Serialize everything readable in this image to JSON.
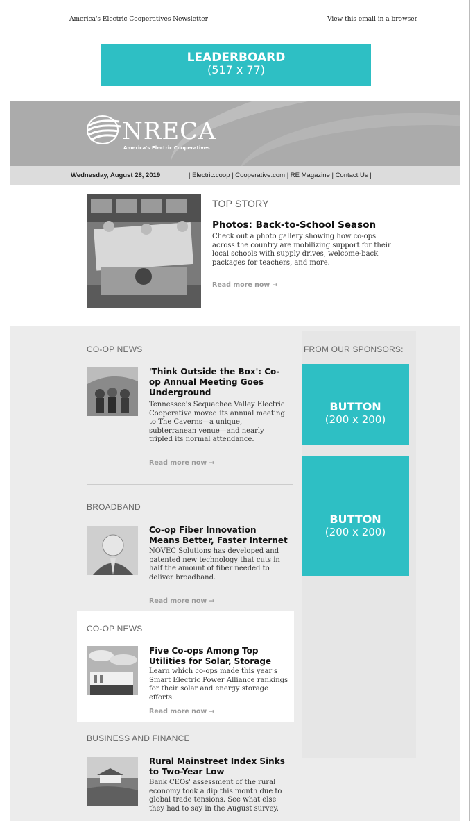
{
  "topbar": {
    "newsletter_title": "America's Electric Cooperatives Newsletter",
    "browser_link": "View this email in a browser"
  },
  "leaderboard": {
    "title": "LEADERBOARD",
    "size": "(517 x 77)"
  },
  "header": {
    "logo_name": "NRECA",
    "logo_sub": "America's Electric Cooperatives",
    "date": "Wednesday, August 28, 2019",
    "links": "| Electric.coop | Cooperative.com | RE Magazine | Contact Us |"
  },
  "top_story": {
    "section": "TOP STORY",
    "headline": "Photos: Back-to-School Season",
    "body": "Check out a photo gallery showing how co-ops across the country are mobilizing support for their local schools with supply drives, welcome-back packages for teachers, and more.",
    "read_more": "Read more now →"
  },
  "articles": [
    {
      "section": "CO-OP NEWS",
      "headline": "'Think Outside the Box': Co-op Annual Meeting Goes Underground",
      "body": "Tennessee's Sequachee Valley Electric Cooperative moved its annual meeting to The Caverns—a unique, subterranean venue—and nearly tripled its normal attendance.",
      "read_more": "Read more now →"
    },
    {
      "section": "BROADBAND",
      "headline": "Co-op Fiber Innovation Means Better, Faster Internet",
      "body": "NOVEC Solutions has developed and patented new technology that cuts in half the amount of fiber needed to deliver broadband.",
      "read_more": "Read more now →"
    },
    {
      "section": "CO-OP NEWS",
      "headline": "Five Co-ops Among Top Utilities for Solar, Storage",
      "body": "Learn which co-ops made this year's Smart Electric Power Alliance rankings for their solar and energy storage efforts.",
      "read_more": "Read more now →"
    },
    {
      "section": "BUSINESS AND FINANCE",
      "headline": "Rural Mainstreet Index Sinks to Two-Year Low",
      "body": "Bank CEOs' assessment of the rural economy took a dip this month due to global trade tensions. See what else they had to say in the August survey."
    }
  ],
  "sponsors": {
    "heading": "FROM OUR SPONSORS:",
    "buttons": [
      {
        "title": "BUTTON",
        "size": "(200 x 200)"
      },
      {
        "title": "BUTTON",
        "size": "(200 x 200)"
      }
    ]
  },
  "colors": {
    "ad_accent": "#2ebfc4",
    "header_gray": "#ababab",
    "panel_gray": "#ececec"
  }
}
